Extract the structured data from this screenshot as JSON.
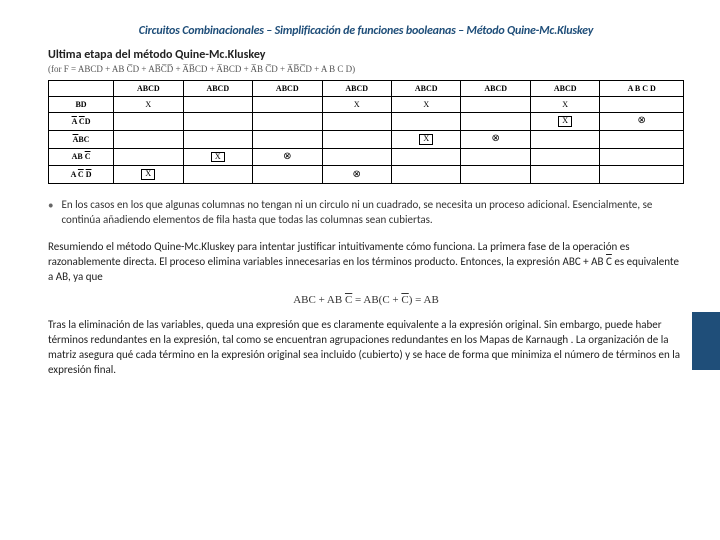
{
  "title": "Circuitos Combinacionales – Simplificación de funciones booleanas – Método Quine-Mc.Kluskey",
  "subtitle": "Ultima etapa del método Quine-Mc.Kluskey",
  "formula_prefix": "(for F = ABCD + AB C̅D + AB̅C̅D̅ + A̅B̅CD + A̅BCD + A̅B C̅D + A̅B̅C̅D + A B C D)",
  "table": {
    "headers": [
      "",
      "ABCD",
      "ABCD",
      "ABCD",
      "ABCD",
      "ABCD",
      "ABCD",
      "ABCD",
      "A B C D"
    ],
    "rows": [
      {
        "label_html": "BD",
        "cells": [
          "X",
          "",
          "",
          "X",
          "X",
          "",
          "X",
          ""
        ]
      },
      {
        "label_html": "A̅ C̅D",
        "cells": [
          "",
          "",
          "",
          "",
          "",
          "",
          "boxed:X",
          "circ"
        ]
      },
      {
        "label_html": "A̅BC",
        "cells": [
          "",
          "",
          "",
          "",
          "boxed:X",
          "circ",
          "",
          ""
        ]
      },
      {
        "label_html": "AB C̅",
        "cells": [
          "",
          "boxed:X",
          "circ",
          "",
          "",
          "",
          "",
          ""
        ]
      },
      {
        "label_html": "A C̅ D̅",
        "cells": [
          "boxed:X",
          "",
          "",
          "circ",
          "",
          "",
          "",
          ""
        ]
      }
    ]
  },
  "bullet": "En los casos en los que algunas columnas no tengan ni un circulo ni un cuadrado, se necesita un proceso adicional. Esencialmente, se continúa añadiendo elementos de fila hasta que todas las columnas sean cubiertas.",
  "para1_a": "Resumiendo el método Quine-Mc.Kluskey para intentar justificar intuitivamente cómo funciona. La primera fase de la operación es razonablemente directa. El proceso elimina variables innecesarias  en los términos producto. Entonces, la expresión ABC + ",
  "para1_b": " es equivalente a AB, ya que",
  "para1_mid_html": "AB C̅",
  "equation_html": "ABC + AB C̅ = AB(C + C̅) = AB",
  "para2": "Tras la eliminación de las variables, queda una expresión que es claramente equivalente a la expresión original. Sin embargo, puede haber  términos  redundantes en  la expresión, tal como se encuentran agrupaciones  redundantes en  los Mapas de Karnaugh . La organización de la matriz asegura qué cada término en la expresión original sea incluido (cubierto) y se hace de forma que minimiza el  número de términos en la expresión  final."
}
